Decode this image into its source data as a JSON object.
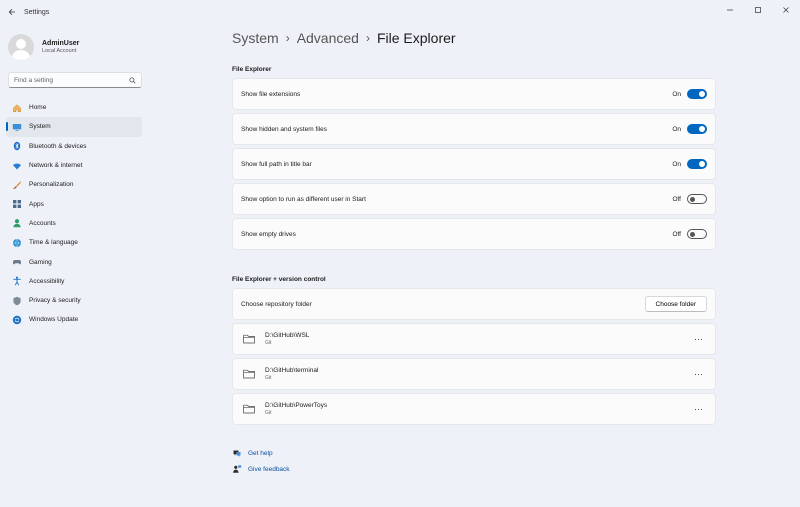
{
  "window": {
    "title": "Settings",
    "back_icon": "arrow-left-icon",
    "controls": [
      "minimize-icon",
      "maximize-icon",
      "close-icon"
    ]
  },
  "profile": {
    "name": "AdminUser",
    "account_type": "Local Account"
  },
  "search": {
    "placeholder": "Find a setting",
    "icon": "search-icon"
  },
  "nav": {
    "items": [
      {
        "label": "Home",
        "icon": "home-icon"
      },
      {
        "label": "System",
        "icon": "monitor-icon",
        "active": true
      },
      {
        "label": "Bluetooth & devices",
        "icon": "bluetooth-icon"
      },
      {
        "label": "Network & internet",
        "icon": "wifi-icon"
      },
      {
        "label": "Personalization",
        "icon": "brush-icon"
      },
      {
        "label": "Apps",
        "icon": "apps-icon"
      },
      {
        "label": "Accounts",
        "icon": "person-icon"
      },
      {
        "label": "Time & language",
        "icon": "globe-icon"
      },
      {
        "label": "Gaming",
        "icon": "gamepad-icon"
      },
      {
        "label": "Accessibility",
        "icon": "accessibility-icon"
      },
      {
        "label": "Privacy & security",
        "icon": "shield-icon"
      },
      {
        "label": "Windows Update",
        "icon": "update-icon"
      }
    ]
  },
  "breadcrumb": {
    "parts": [
      "System",
      "Advanced"
    ],
    "current": "File Explorer",
    "separator": "›"
  },
  "file_explorer": {
    "heading": "File Explorer",
    "settings": [
      {
        "label": "Show file extensions",
        "state": "On"
      },
      {
        "label": "Show hidden and system files",
        "state": "On"
      },
      {
        "label": "Show full path in title bar",
        "state": "On"
      },
      {
        "label": "Show option to run as different user in Start",
        "state": "Off"
      },
      {
        "label": "Show empty drives",
        "state": "Off"
      }
    ]
  },
  "version_control": {
    "heading": "File Explorer + version control",
    "choose_label": "Choose repository folder",
    "choose_button": "Choose folder",
    "repos": [
      {
        "path": "D:\\GitHub\\WSL",
        "type": "Git"
      },
      {
        "path": "D:\\GitHub\\terminal",
        "type": "Git"
      },
      {
        "path": "D:\\GitHub\\PowerToys",
        "type": "Git"
      }
    ],
    "more_label": "···"
  },
  "links": {
    "help": "Get help",
    "feedback": "Give feedback"
  },
  "colors": {
    "accent": "#0067c0",
    "background": "#eef2f8",
    "card": "#fbfbfc"
  }
}
